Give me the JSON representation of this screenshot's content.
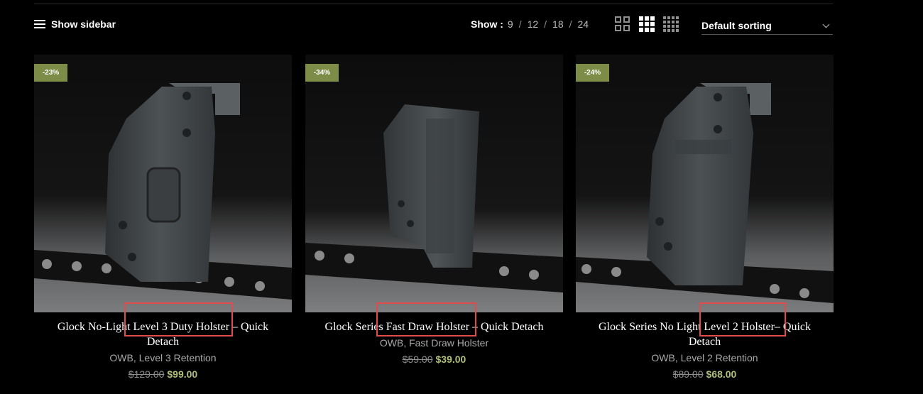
{
  "toolbar": {
    "sidebar_label": "Show sidebar",
    "show_label": "Show :",
    "per_page_options": [
      "9",
      "12",
      "18",
      "24"
    ],
    "sort_label": "Default sorting"
  },
  "products": [
    {
      "badge": "-23%",
      "title": "Glock No-Light Level 3 Duty Holster – Quick Detach",
      "category": "OWB, Level 3 Retention",
      "old_price": "$129.00",
      "price": "$99.00"
    },
    {
      "badge": "-34%",
      "title": "Glock Series Fast Draw Holster – Quick Detach",
      "category": "OWB, Fast Draw Holster",
      "old_price": "$59.00",
      "price": "$39.00"
    },
    {
      "badge": "-24%",
      "title": "Glock Series No Light Level 2 Holster– Quick Detach",
      "category": "OWB, Level 2 Retention",
      "old_price": "$89.00",
      "price": "$68.00"
    }
  ],
  "colors": {
    "badge_bg": "#7d8c47",
    "sale_price": "#b0bf7a",
    "highlight": "#e04b4b"
  }
}
